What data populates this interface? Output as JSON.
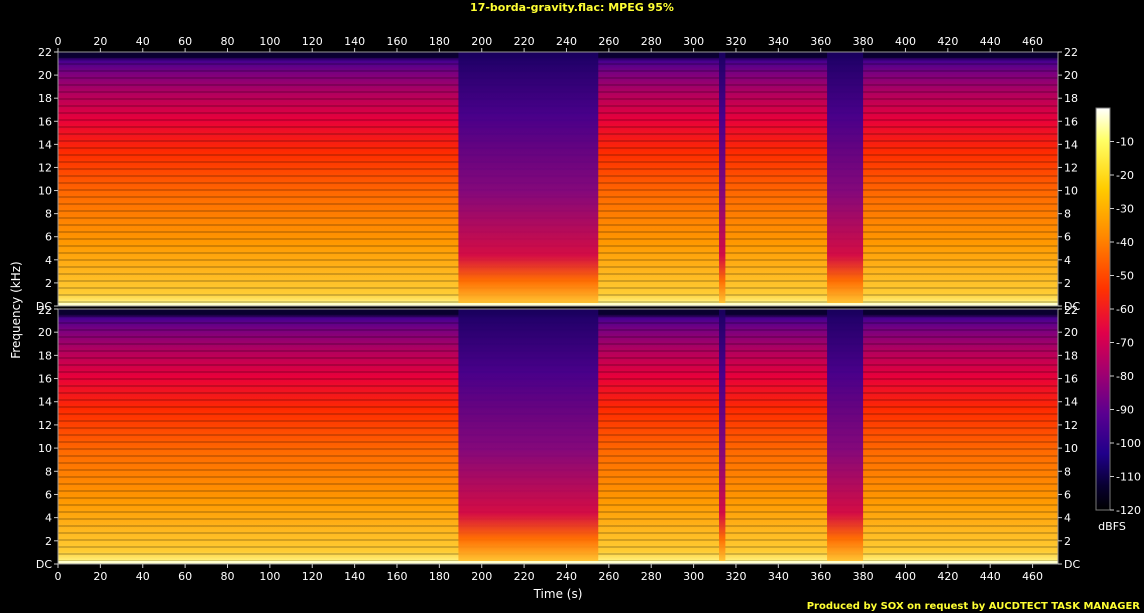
{
  "chart_data": {
    "type": "heatmap",
    "title": "17-borda-gravity.flac: MPEG 95%",
    "xlabel": "Time (s)",
    "ylabel": "Frequency (kHz)",
    "xlim": [
      0,
      472
    ],
    "ylim": [
      0,
      22
    ],
    "x_ticks": [
      "0",
      "20",
      "40",
      "60",
      "80",
      "100",
      "120",
      "140",
      "160",
      "180",
      "200",
      "220",
      "240",
      "260",
      "280",
      "300",
      "320",
      "340",
      "360",
      "380",
      "400",
      "420",
      "440",
      "460"
    ],
    "y_ticks": [
      "DC",
      "2",
      "4",
      "6",
      "8",
      "10",
      "12",
      "14",
      "16",
      "18",
      "20",
      "22"
    ],
    "channels": 2,
    "colorbar": {
      "label": "dBFS",
      "ticks": [
        "-10",
        "-20",
        "-30",
        "-40",
        "-50",
        "-60",
        "-70",
        "-80",
        "-90",
        "-100",
        "-110",
        "-120"
      ],
      "range": [
        -120,
        0
      ]
    },
    "quiet_segments_s": [
      [
        189,
        255
      ],
      [
        312,
        315
      ],
      [
        363,
        380
      ]
    ],
    "cutoff_khz": 21.5,
    "colors": {
      "high": "#ffffcc",
      "mid": "#ff6a00",
      "low": "#6a0080",
      "floor": "#000000"
    }
  },
  "footer": "Produced by SOX on request by AUCDTECT TASK MANAGER"
}
